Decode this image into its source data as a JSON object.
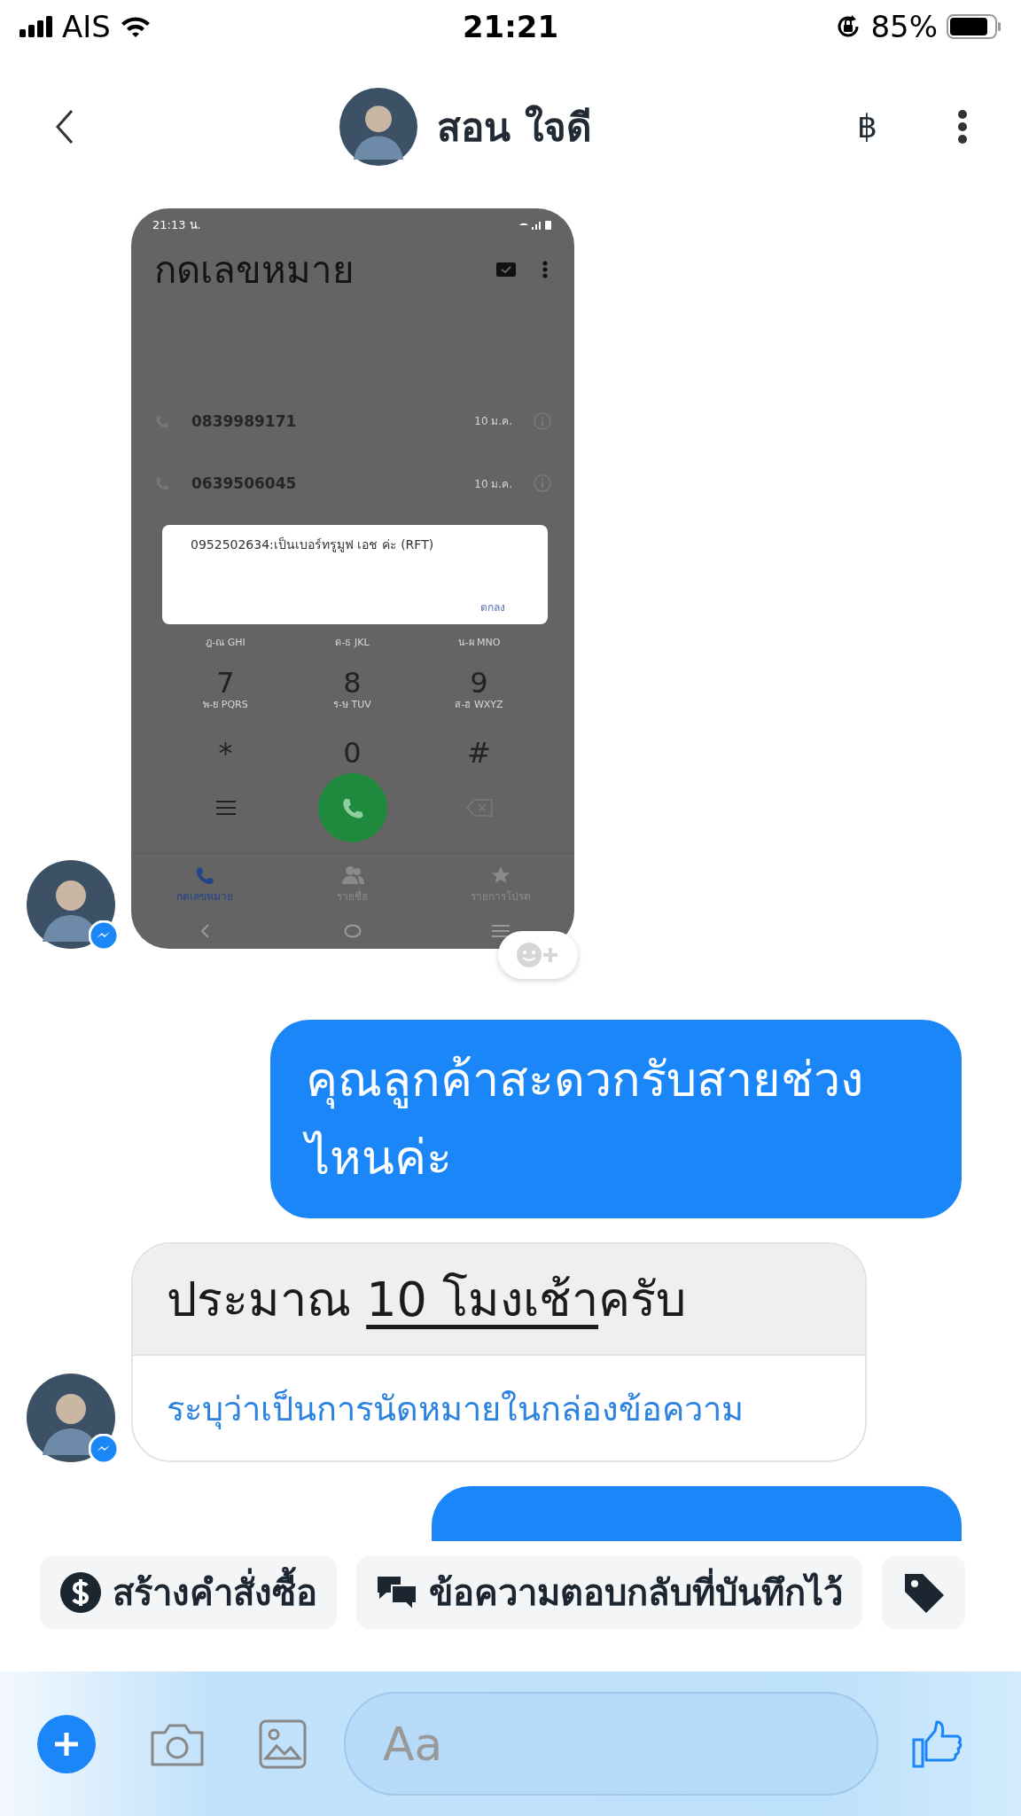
{
  "status_bar": {
    "carrier": "AIS",
    "time": "21:21",
    "battery": "85%"
  },
  "header": {
    "contact_name": "สอน ใจดี",
    "currency_symbol": "฿"
  },
  "messages": [
    {
      "kind": "image",
      "outgoing": false,
      "screenshot": {
        "status_time": "21:13 น.",
        "title": "กดเลขหมาย",
        "recent_calls": [
          {
            "number": "0839989171",
            "date": "10 ม.ค."
          },
          {
            "number": "0639506045",
            "date": "10 ม.ค."
          }
        ],
        "dialog": {
          "message": "0952502634:เป็นเบอร์ทรูมูฟ เอช ค่ะ (RFT)",
          "button": "ตกลง"
        },
        "keypad": [
          {
            "letters": "ฎ-ณ GHI"
          },
          {
            "letters": "ด-ธ JKL"
          },
          {
            "letters": "น-ผ MNO"
          },
          {
            "digit": "7",
            "letters": "พ-ย PQRS"
          },
          {
            "digit": "8",
            "letters": "ร-ษ TUV"
          },
          {
            "digit": "9",
            "letters": "ส-ฮ WXYZ"
          },
          {
            "digit": "*"
          },
          {
            "digit": "0"
          },
          {
            "digit": "#"
          }
        ],
        "tabs": [
          {
            "label": "กดเลขหมาย",
            "selected": true,
            "kind": "phone"
          },
          {
            "label": "รายชื่อ",
            "selected": false,
            "kind": "people"
          },
          {
            "label": "รายการโปรด",
            "selected": false,
            "kind": "star"
          }
        ]
      }
    },
    {
      "kind": "text",
      "outgoing": true,
      "text": "คุณลูกค้าสะดวกรับสายช่วงไหนค่ะ"
    },
    {
      "kind": "suggestion",
      "outgoing": false,
      "before": "ประมาณ ",
      "underlined": "10 โมงเช้า",
      "after": "ครับ",
      "action": "ระบุว่าเป็นการนัดหมายในกล่องข้อความ"
    },
    {
      "kind": "partial",
      "outgoing": true
    }
  ],
  "quick_replies": [
    {
      "kind": "dollar",
      "label": "สร้างคำสั่งซื้อ"
    },
    {
      "kind": "chat",
      "label": "ข้อความตอบกลับที่บันทึกไว้"
    },
    {
      "kind": "tag"
    }
  ],
  "composer": {
    "placeholder": "Aa"
  }
}
